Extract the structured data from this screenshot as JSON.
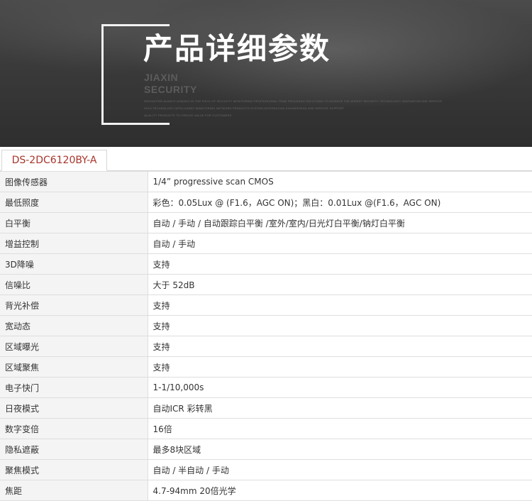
{
  "banner": {
    "title": "产品详细参数",
    "brand_line1": "JIAXIN",
    "brand_line2": "SECURITY",
    "fine_line1": "INNOVATION ALWAYS LEADING IN THE FIELD OF SECURITY MONITORING PROFESSIONAL TEAM PROVIDING SOLUTIONS TO ACHIEVE THE WIDEST SECURITY TECHNOLOGY INNOVATION AND SERVICE",
    "fine_line2": "HIGH TECHNOLOGY INTELLIGENT MONITORING NETWORK PRODUCTS SYSTEM INTEGRATION ENGINEERING AND SERVICE SUPPORT",
    "fine_line3": "QUALITY PRODUCTS TO CREATE VALUE FOR CUSTOMERS"
  },
  "tab": {
    "model_label": "DS-2DC6120BY-A"
  },
  "specs": [
    {
      "label": "图像传感器",
      "value": "1/4”  progressive scan CMOS"
    },
    {
      "label": "最低照度",
      "value": "彩色：0.05Lux @ (F1.6，AGC ON)；黑白：0.01Lux @(F1.6，AGC ON)"
    },
    {
      "label": "白平衡",
      "value": "自动 / 手动 / 自动跟踪白平衡 /室外/室内/日光灯白平衡/钠灯白平衡"
    },
    {
      "label": "增益控制",
      "value": "自动 / 手动"
    },
    {
      "label": "3D降噪",
      "value": "支持"
    },
    {
      "label": "信噪比",
      "value": "大于 52dB"
    },
    {
      "label": "背光补偿",
      "value": "支持"
    },
    {
      "label": "宽动态",
      "value": "支持"
    },
    {
      "label": "区域曝光",
      "value": "支持"
    },
    {
      "label": "区域聚焦",
      "value": "支持"
    },
    {
      "label": "电子快门",
      "value": "1-1/10,000s"
    },
    {
      "label": "日夜模式",
      "value": "自动ICR 彩转黑"
    },
    {
      "label": "数字变倍",
      "value": "16倍"
    },
    {
      "label": "隐私遮蔽",
      "value": "最多8块区域"
    },
    {
      "label": "聚焦模式",
      "value": "自动 / 半自动 / 手动"
    },
    {
      "label": "焦距",
      "value": "4.7-94mm 20倍光学"
    }
  ]
}
